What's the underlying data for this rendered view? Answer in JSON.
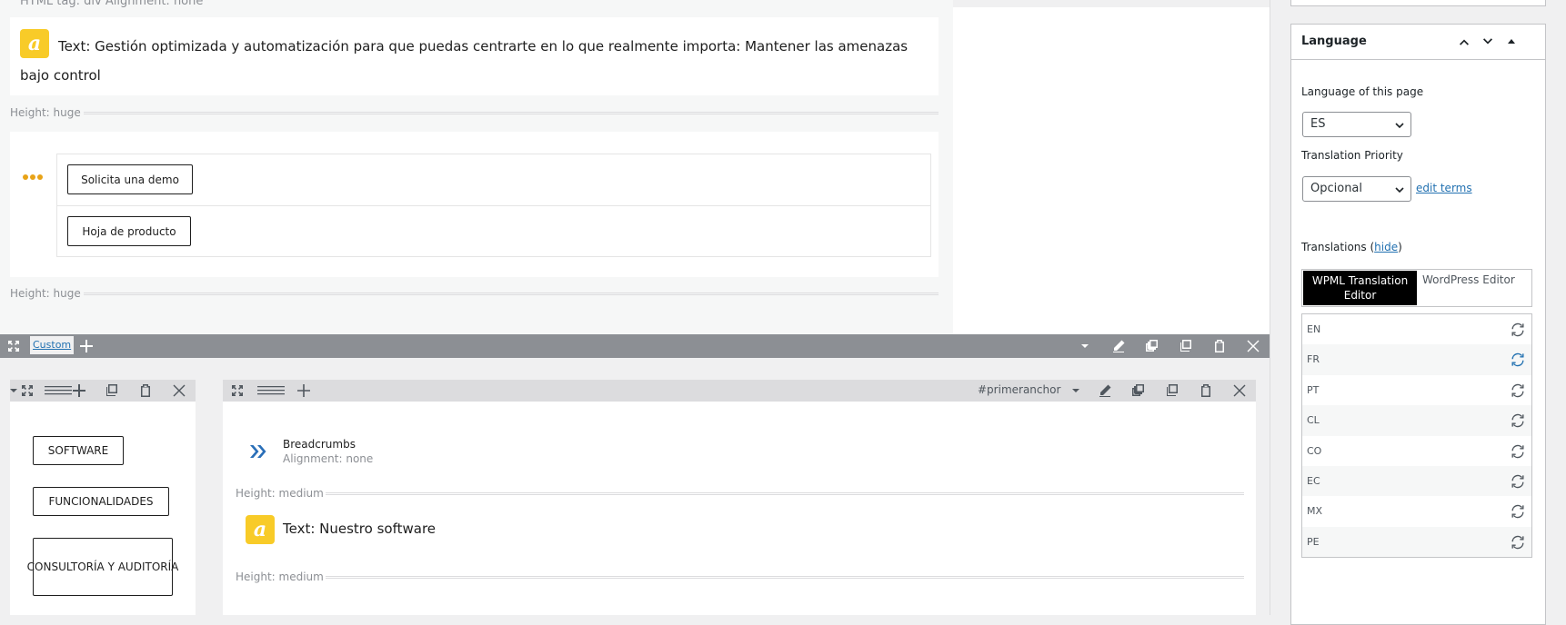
{
  "editor": {
    "top_meta": "HTML tag: div     Alignment: none",
    "text_module": {
      "icon_letter": "a",
      "text": "Text: Gestión optimizada y automatización para que puedas centrarte en lo que realmente importa: Mantener las amenazas bajo control"
    },
    "height_label_1": "Height: huge",
    "buttons": [
      "Solicita una demo",
      "Hoja de producto"
    ],
    "height_label_2": "Height: huge"
  },
  "section_bar": {
    "label": "Custom"
  },
  "col1": {
    "buttons": [
      "SOFTWARE",
      "FUNCIONALIDADES",
      "CONSULTORÍA Y AUDITORÍA"
    ]
  },
  "col2": {
    "anchor": "#primeranchor",
    "breadcrumbs_title": "Breadcrumbs",
    "breadcrumbs_sub": "Alignment: none",
    "height_label_1": "Height: medium",
    "text_icon_letter": "a",
    "text_title": "Text: Nuestro software",
    "height_label_2": "Height: medium"
  },
  "sidebar": {
    "panel_title": "Language",
    "language_label": "Language of this page",
    "language_value": "ES",
    "priority_label": "Translation Priority",
    "priority_value": "Opcional",
    "edit_terms": "edit terms",
    "translations_label": "Translations",
    "hide_link": "hide",
    "tab_wpml": "WPML Translation Editor",
    "tab_wp": "WordPress Editor",
    "languages": [
      {
        "code": "EN"
      },
      {
        "code": "FR"
      },
      {
        "code": "PT"
      },
      {
        "code": "CL"
      },
      {
        "code": "CO"
      },
      {
        "code": "EC"
      },
      {
        "code": "MX"
      },
      {
        "code": "PE"
      }
    ]
  },
  "colors": {
    "accent_yellow": "#f8cb28",
    "link_blue": "#2271b1",
    "breadcrumb_blue": "#2a6fb8",
    "toolbar_gray": "#8c8f94"
  }
}
